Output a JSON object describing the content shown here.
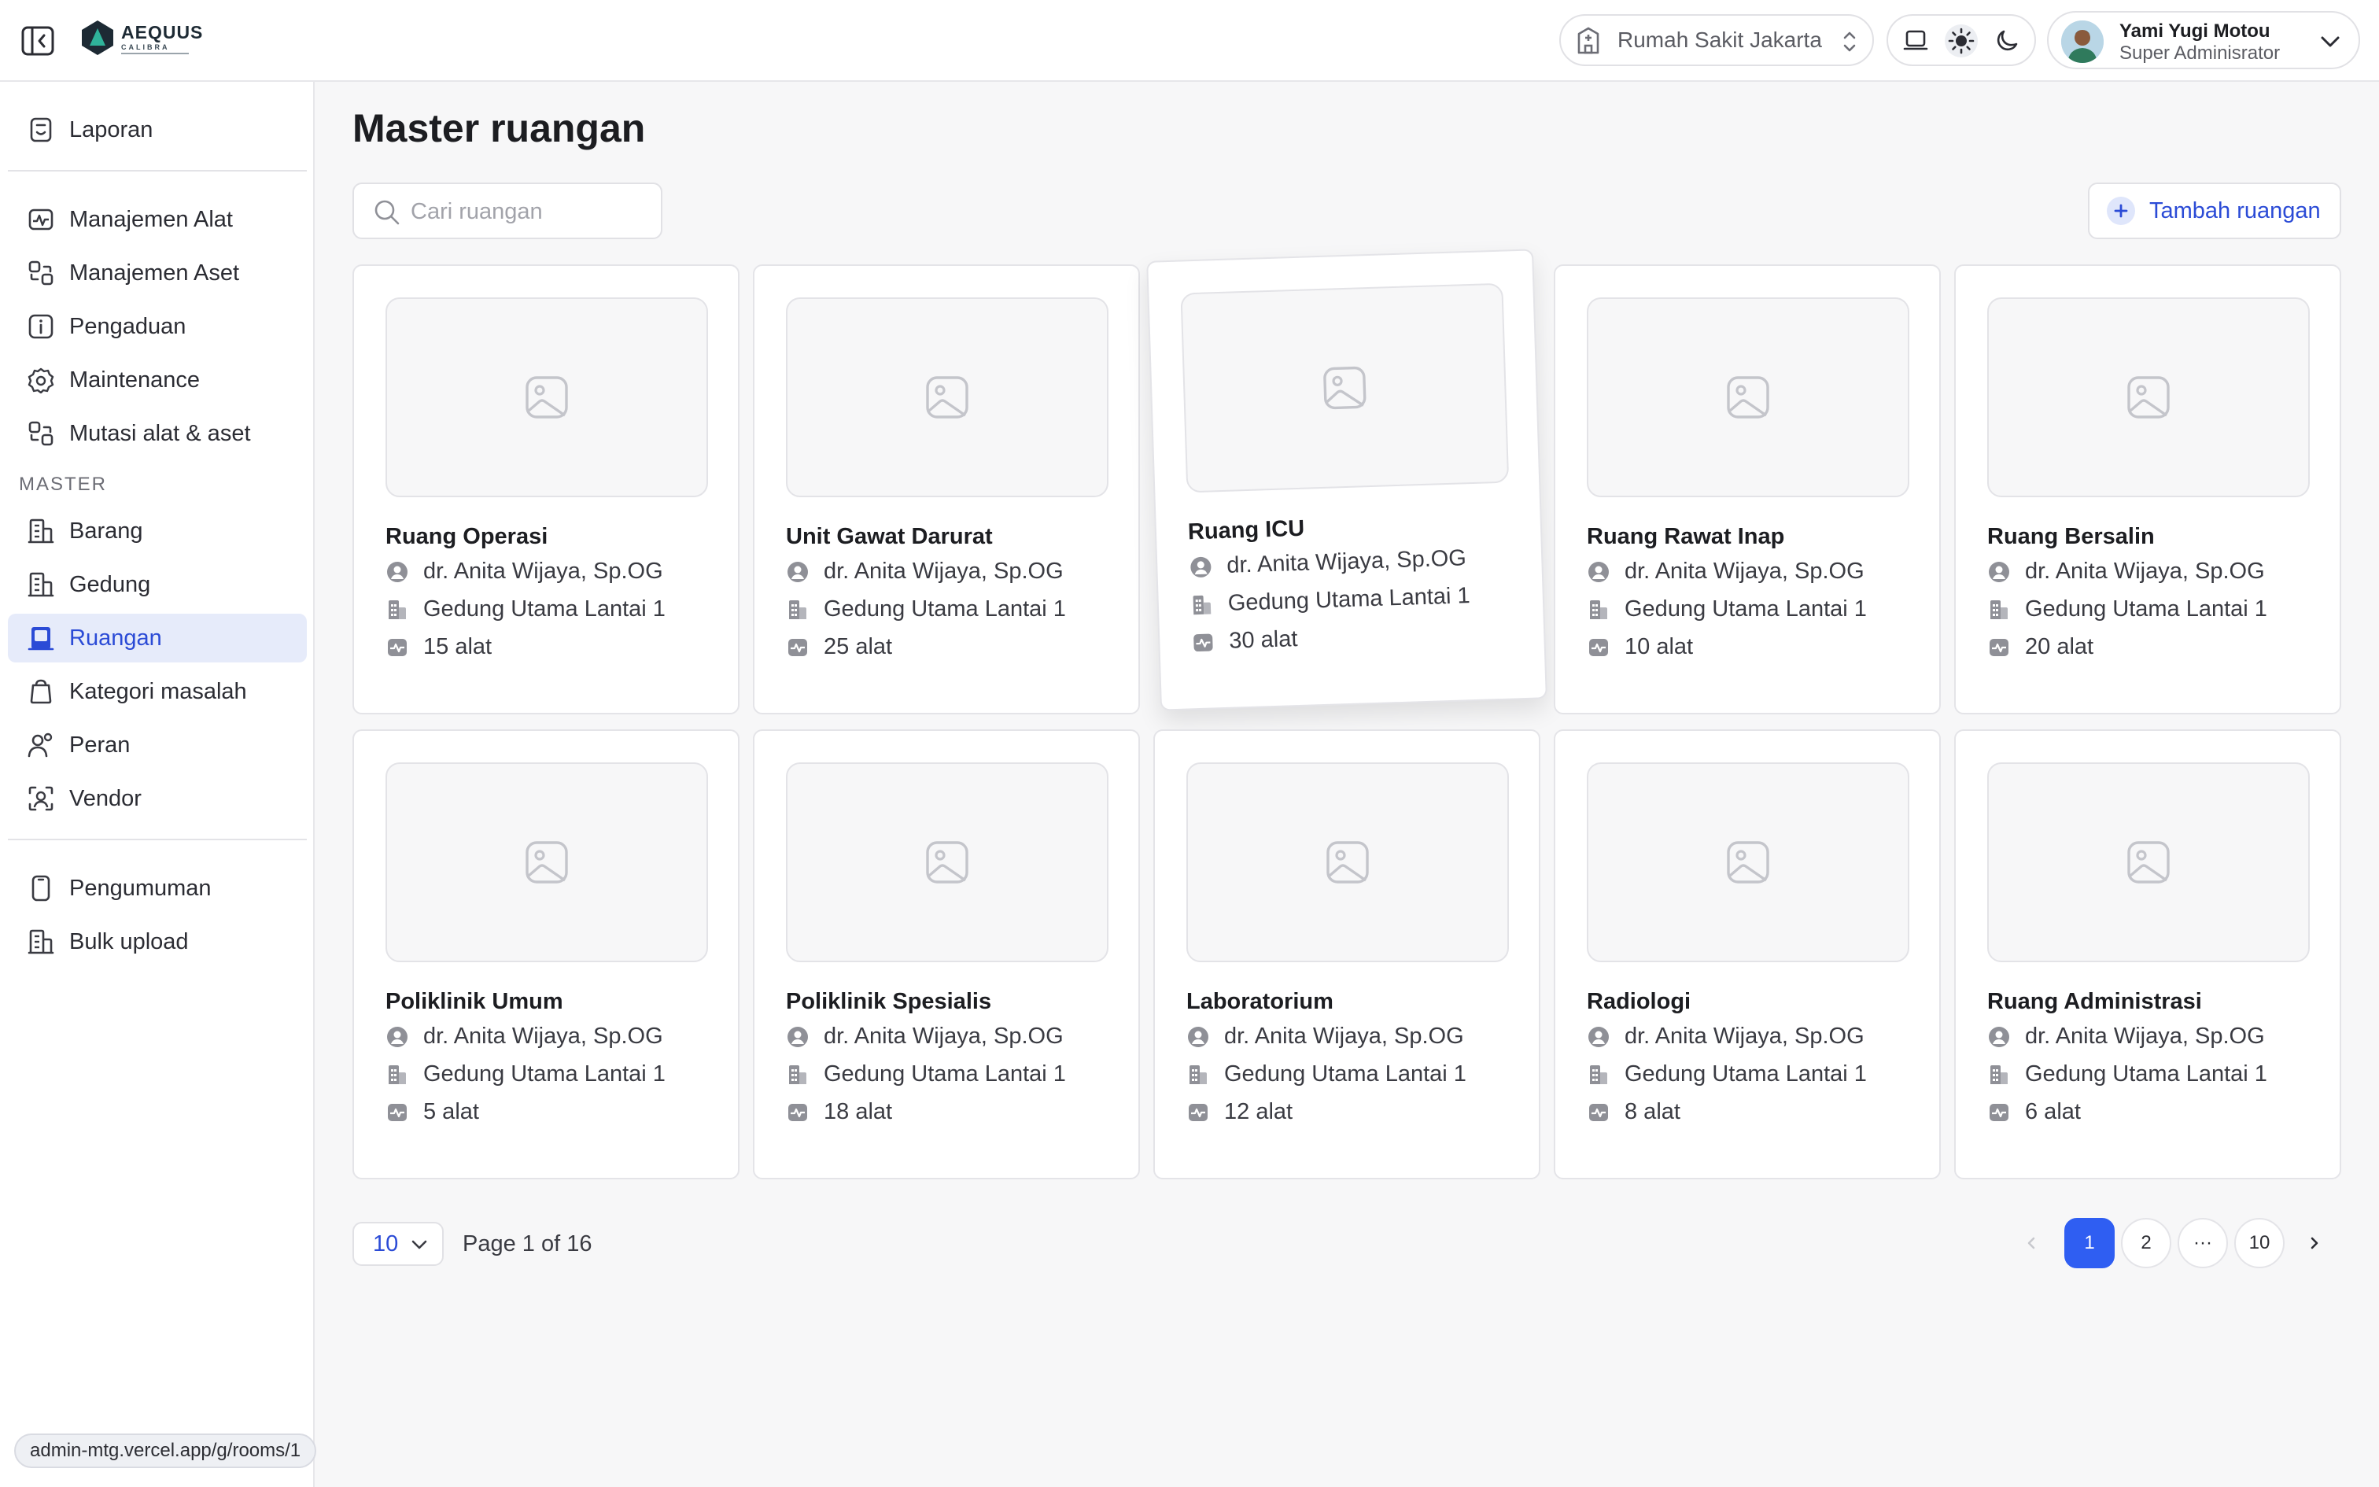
{
  "topbar": {
    "logo_text": "AEQUUS",
    "logo_sub": "CALIBRA",
    "hospital": "Rumah Sakit Jakarta",
    "user_name": "Yami Yugi Motou",
    "user_role": "Super Adminisrator"
  },
  "sidebar": {
    "items": [
      {
        "label": "Laporan",
        "icon": "report-icon"
      },
      {
        "label": "Manajemen Alat",
        "icon": "monitor-icon"
      },
      {
        "label": "Manajemen Aset",
        "icon": "asset-icon"
      },
      {
        "label": "Pengaduan",
        "icon": "info-icon"
      },
      {
        "label": "Maintenance",
        "icon": "gear-icon"
      },
      {
        "label": "Mutasi alat & aset",
        "icon": "transfer-icon"
      }
    ],
    "section_label": "MASTER",
    "master_items": [
      {
        "label": "Barang",
        "icon": "building-icon"
      },
      {
        "label": "Gedung",
        "icon": "building-icon"
      },
      {
        "label": "Ruangan",
        "icon": "room-icon",
        "active": true
      },
      {
        "label": "Kategori masalah",
        "icon": "bag-icon"
      },
      {
        "label": "Peran",
        "icon": "users-icon"
      },
      {
        "label": "Vendor",
        "icon": "vendor-icon"
      }
    ],
    "bottom_items": [
      {
        "label": "Pengumuman",
        "icon": "phone-icon"
      },
      {
        "label": "Bulk upload",
        "icon": "building-icon"
      }
    ]
  },
  "status_url": "admin-mtg.vercel.app/g/rooms/1",
  "main": {
    "title": "Master ruangan",
    "search_placeholder": "Cari ruangan",
    "add_button": "Tambah ruangan",
    "cards": [
      {
        "name": "Ruang Operasi",
        "pic": "dr. Anita Wijaya, Sp.OG",
        "building": "Gedung Utama Lantai 1",
        "count": "15 alat"
      },
      {
        "name": "Unit Gawat Darurat",
        "pic": "dr. Anita Wijaya, Sp.OG",
        "building": "Gedung Utama Lantai 1",
        "count": "25 alat"
      },
      {
        "name": "Ruang ICU",
        "pic": "dr. Anita Wijaya, Sp.OG",
        "building": "Gedung Utama Lantai 1",
        "count": "30 alat"
      },
      {
        "name": "Ruang Rawat Inap",
        "pic": "dr. Anita Wijaya, Sp.OG",
        "building": "Gedung Utama Lantai 1",
        "count": "10 alat"
      },
      {
        "name": "Ruang Bersalin",
        "pic": "dr. Anita Wijaya, Sp.OG",
        "building": "Gedung Utama Lantai 1",
        "count": "20 alat"
      },
      {
        "name": "Poliklinik Umum",
        "pic": "dr. Anita Wijaya, Sp.OG",
        "building": "Gedung Utama Lantai 1",
        "count": "5 alat"
      },
      {
        "name": "Poliklinik Spesialis",
        "pic": "dr. Anita Wijaya, Sp.OG",
        "building": "Gedung Utama Lantai 1",
        "count": "18 alat"
      },
      {
        "name": "Laboratorium",
        "pic": "dr. Anita Wijaya, Sp.OG",
        "building": "Gedung Utama Lantai 1",
        "count": "12 alat"
      },
      {
        "name": "Radiologi",
        "pic": "dr. Anita Wijaya, Sp.OG",
        "building": "Gedung Utama Lantai 1",
        "count": "8 alat"
      },
      {
        "name": "Ruang Administrasi",
        "pic": "dr. Anita Wijaya, Sp.OG",
        "building": "Gedung Utama Lantai 1",
        "count": "6 alat"
      }
    ]
  },
  "pagination": {
    "per_page": "10",
    "page_info": "Page 1 of 16",
    "pages": [
      "1",
      "2",
      "···",
      "10"
    ],
    "current": "1"
  },
  "colors": {
    "accent": "#2f5ef2",
    "accent_text": "#2b4bd6",
    "active_bg": "#e6ebfa"
  }
}
